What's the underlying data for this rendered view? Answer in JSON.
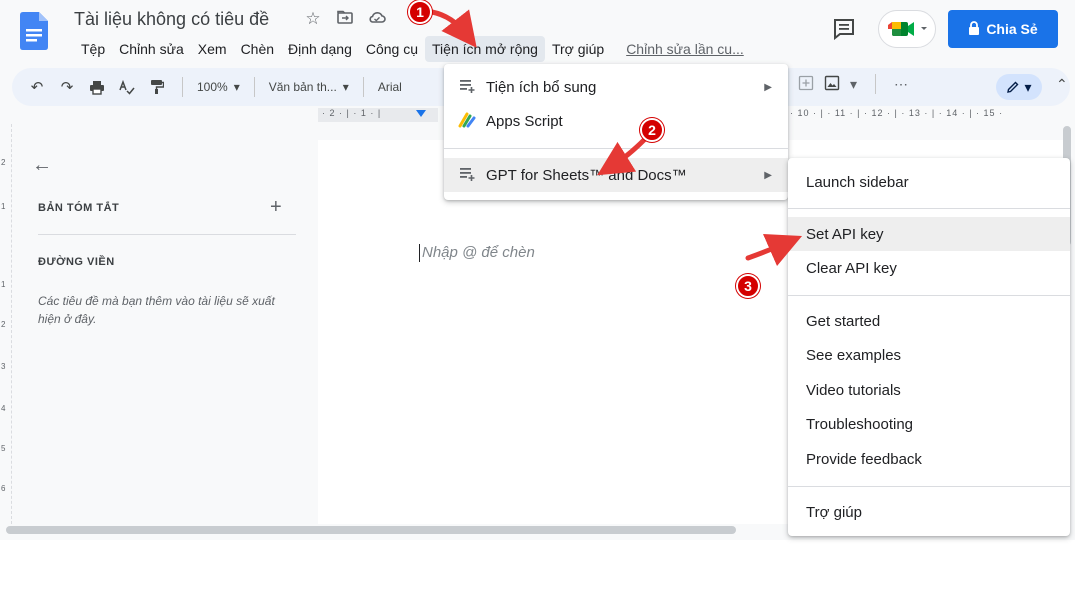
{
  "title_bar": {
    "doc_title": "Tài liệu không có tiêu đề",
    "icons": [
      "star-icon",
      "folder-move-icon",
      "cloud-status-icon"
    ],
    "share_label": "Chia Sẻ"
  },
  "menu": {
    "items": [
      "Tệp",
      "Chỉnh sửa",
      "Xem",
      "Chèn",
      "Định dạng",
      "Công cụ",
      "Tiện ích mở rộng",
      "Trợ giúp"
    ],
    "active_index": 6,
    "last_edit": "Chỉnh sửa lần cu..."
  },
  "toolbar": {
    "zoom": "100%",
    "style": "Văn bản th...",
    "font": "Arial",
    "more": "⋯"
  },
  "ruler": {
    "left_numbers": "· 2 · | · 1 · |",
    "right_numbers": "· 10 · | · 11 · | · 12 · | · 13 · | · 14 · | · 15 ·"
  },
  "vertical_ruler": [
    "2",
    "1",
    "1",
    "2",
    "3",
    "4",
    "5",
    "6"
  ],
  "outline": {
    "summary_label": "BẢN TÓM TẮT",
    "heading_label": "ĐƯỜNG VIỀN",
    "note": "Các tiêu đề mà bạn thêm vào tài liệu sẽ xuất hiện ở đây."
  },
  "document": {
    "placeholder": "Nhập @ để chèn"
  },
  "extensions_menu": {
    "items": [
      {
        "label": "Tiện ích bổ sung",
        "icon": "addon-icon",
        "has_submenu": true
      },
      {
        "label": "Apps Script",
        "icon": "apps-script-icon",
        "has_submenu": false
      },
      {
        "label": "GPT for Sheets™ and Docs™",
        "icon": "addon-icon",
        "has_submenu": true
      }
    ],
    "highlighted_index": 2
  },
  "gpt_submenu": {
    "items": [
      "Launch sidebar",
      "Set API key",
      "Clear API key",
      "Get started",
      "See examples",
      "Video tutorials",
      "Troubleshooting",
      "Provide feedback",
      "Trợ giúp"
    ],
    "highlighted_index": 1
  },
  "annotations": {
    "badges": [
      "1",
      "2",
      "3"
    ],
    "color": "#d40000"
  },
  "colors": {
    "accent": "#1a73e8",
    "background": "#f8f9fa",
    "toolbar": "#edf2fa"
  }
}
